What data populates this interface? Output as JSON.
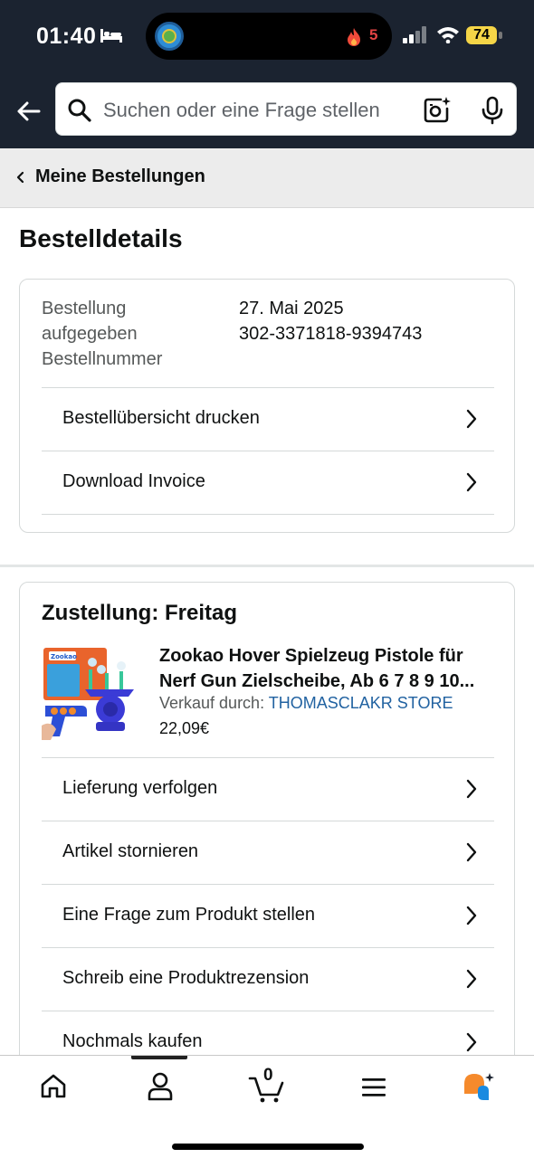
{
  "status_bar": {
    "time": "01:40",
    "streak_count": "5",
    "battery": "74"
  },
  "search": {
    "placeholder": "Suchen oder eine Frage stellen"
  },
  "breadcrumb": {
    "label": "Meine Bestellungen"
  },
  "page": {
    "title": "Bestelldetails"
  },
  "order": {
    "labels": [
      "Bestellung",
      "aufgegeben",
      "Bestellnummer"
    ],
    "date": "27. Mai 2025",
    "number": "302-3371818-9394743",
    "actions": [
      {
        "label": "Bestellübersicht drucken"
      },
      {
        "label": "Download Invoice"
      }
    ]
  },
  "shipment": {
    "heading": "Zustellung: Freitag",
    "product": {
      "title_line1": "Zookao Hover Spielzeug Pistole für",
      "title_line2": "Nerf Gun Zielscheibe, Ab 6 7 8 9 10...",
      "seller_prefix": "Verkauf durch:",
      "seller_name": "THOMASCLAKR STORE",
      "price": "22,09€"
    },
    "actions": [
      {
        "label": "Lieferung verfolgen"
      },
      {
        "label": "Artikel stornieren"
      },
      {
        "label": "Eine Frage zum Produkt stellen"
      },
      {
        "label": "Schreib eine Produktrezension"
      },
      {
        "label": "Nochmals kaufen"
      }
    ]
  },
  "bottom_nav": {
    "items": [
      "home-icon",
      "account-icon",
      "cart-icon",
      "menu-icon",
      "rufus-icon"
    ],
    "cart_count": "0"
  },
  "colors": {
    "header_bg": "#1b2330",
    "link": "#2162a1",
    "battery": "#f5d547"
  }
}
